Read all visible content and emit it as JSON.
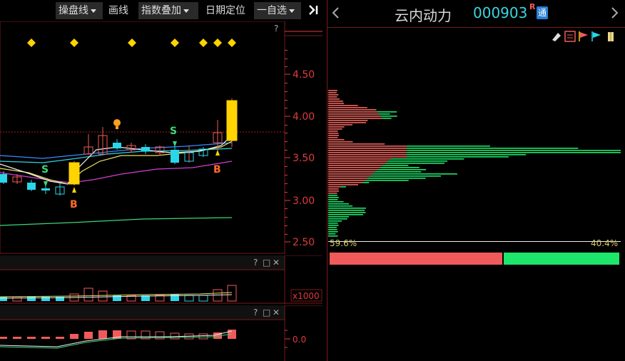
{
  "toolbar": {
    "operate_line": "操盘线",
    "draw": "画线",
    "index_overlay": "指数叠加",
    "date_locate": "日期定位",
    "watchlist": "一自选",
    "collapse_glyph": "▸|"
  },
  "main_chart": {
    "help": "?",
    "price_axis": [
      "4.50",
      "4.00",
      "3.50",
      "3.00",
      "2.50"
    ],
    "signal_labels": {
      "sell": "S",
      "buy": "B"
    }
  },
  "volume_pane": {
    "help": "?",
    "window_icons": [
      "□",
      "✕"
    ],
    "axis_label": "x1000"
  },
  "indicator_pane": {
    "help": "?",
    "window_icons": [
      "□",
      "✕"
    ],
    "axis_label": "0.0"
  },
  "stock": {
    "name": "云内动力",
    "code": "000903",
    "r_badge": "R",
    "tong_badge": "通"
  },
  "chip_distribution": {
    "profit_ratio": "59.6%",
    "loss_ratio": "40.4%",
    "profit_fraction": 0.596,
    "colors": {
      "profit": "#f05a5a",
      "loss": "#1ee66a"
    }
  },
  "colors": {
    "up": "#f05a5a",
    "down": "#2ad6ea",
    "axis_red": "#e03a3a",
    "highlight_yellow": "#ffd400"
  }
}
